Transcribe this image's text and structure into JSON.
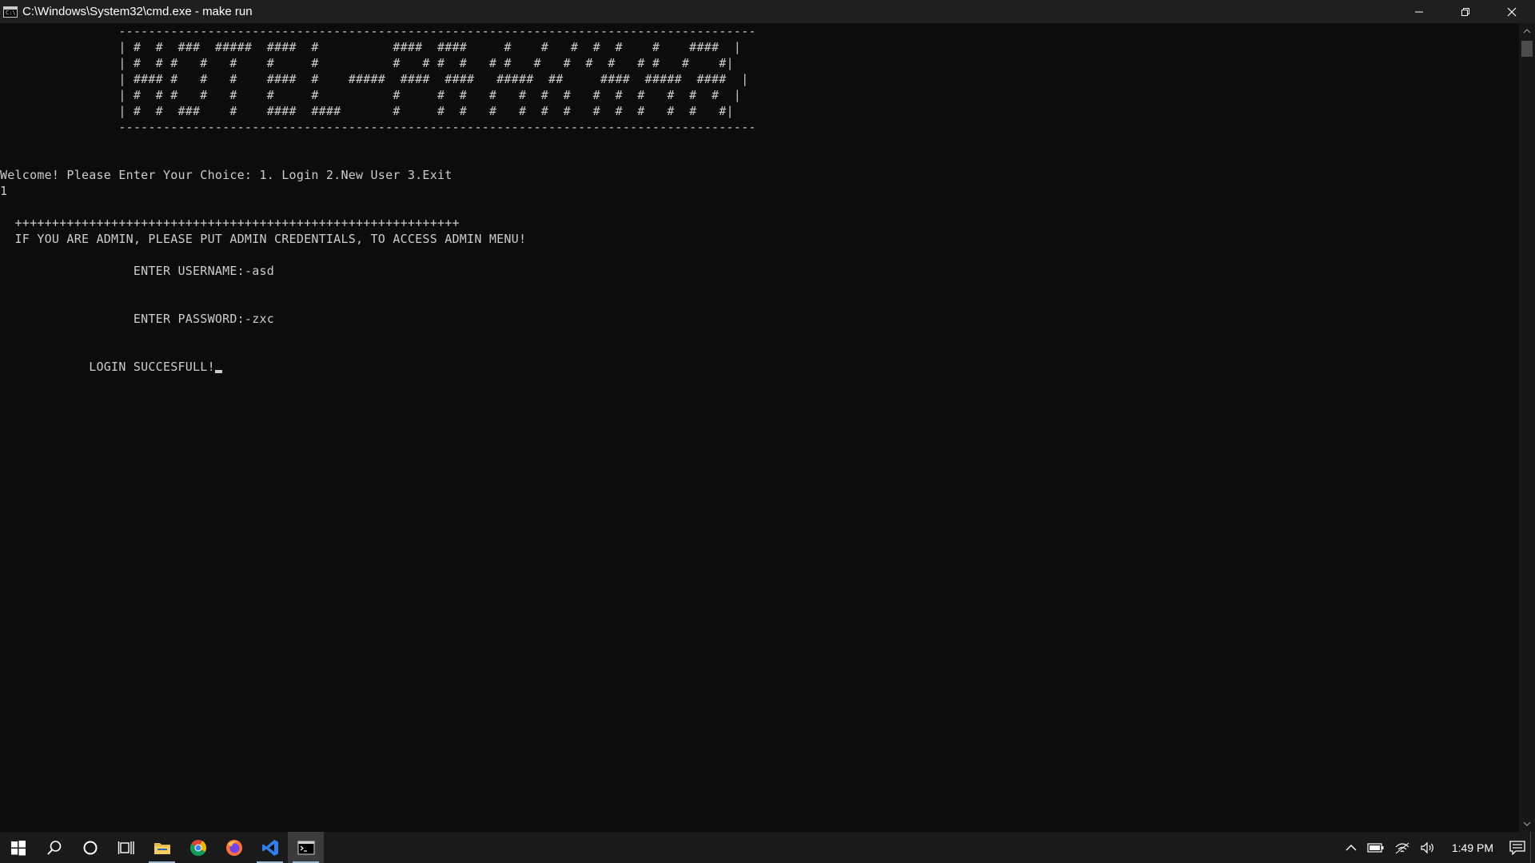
{
  "window": {
    "title": "C:\\Windows\\System32\\cmd.exe - make  run",
    "icon": "cmd-icon"
  },
  "console": {
    "lines": [
      "                --------------------------------------------------------------------------------------",
      "                | #  #  ###  #####  ####  #          ####  ####     #    #   #  #  #    #    ####  |",
      "                | #  # #   #   #    #     #          #   # #  #   # #   #   #  #  #   # #   #    #|",
      "                | #### #   #   #    ####  #    #####  ####  ####   #####  ##     ####  #####  ####  |",
      "                | #  # #   #   #    #     #          #     #  #   #   #  #  #   #  #  #   #  #  #  |",
      "                | #  #  ###    #    ####  ####       #     #  #   #   #  #  #   #  #  #   #  #   #|",
      "                --------------------------------------------------------------------------------------",
      "",
      "",
      "Welcome! Please Enter Your Choice: 1. Login 2.New User 3.Exit",
      "1",
      "",
      "  ++++++++++++++++++++++++++++++++++++++++++++++++++++++++++++",
      "  IF YOU ARE ADMIN, PLEASE PUT ADMIN CREDENTIALS, TO ACCESS ADMIN MENU!",
      "",
      "                  ENTER USERNAME:-asd",
      "",
      "",
      "                  ENTER PASSWORD:-zxc",
      "",
      "",
      "            LOGIN SUCCESFULL!"
    ]
  },
  "taskbar": {
    "items": [
      {
        "name": "start-button",
        "icon": "windows-logo-icon"
      },
      {
        "name": "search-button",
        "icon": "search-icon"
      },
      {
        "name": "cortana-button",
        "icon": "cortana-circle-icon"
      },
      {
        "name": "task-view-button",
        "icon": "task-view-icon"
      },
      {
        "name": "file-explorer-button",
        "icon": "folder-icon"
      },
      {
        "name": "chrome-button",
        "icon": "chrome-icon"
      },
      {
        "name": "firefox-button",
        "icon": "firefox-icon"
      },
      {
        "name": "vscode-button",
        "icon": "vscode-icon"
      },
      {
        "name": "cmd-button",
        "icon": "cmd-icon"
      }
    ],
    "tray": {
      "icons": [
        "chevron-up-icon",
        "battery-icon",
        "wifi-icon",
        "volume-icon",
        "notification-icon"
      ],
      "clock": "1:49 PM"
    }
  },
  "colors": {
    "console_bg": "#0c0c0c",
    "console_text": "#cccccc",
    "titlebar_bg": "#1f1f1f",
    "taskbar_bg": "#1a1a1a",
    "vscode_blue": "#2f80ed"
  }
}
